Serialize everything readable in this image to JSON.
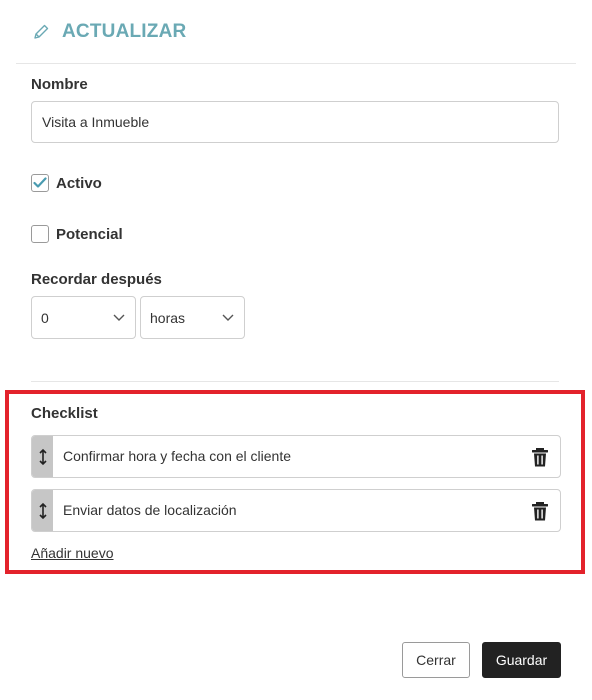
{
  "header": {
    "title": "ACTUALIZAR",
    "icon": "pencil-icon",
    "accent": "#6aa9b4"
  },
  "form": {
    "name_label": "Nombre",
    "name_value": "Visita a Inmueble",
    "active": {
      "label": "Activo",
      "checked": true
    },
    "potential": {
      "label": "Potencial",
      "checked": false
    },
    "remind_label": "Recordar después",
    "remind_value": "0",
    "remind_unit": "horas"
  },
  "checklist": {
    "title": "Checklist",
    "highlight_color": "#e3222b",
    "items": [
      {
        "text": "Confirmar hora y fecha con el cliente"
      },
      {
        "text": "Enviar datos de localización"
      }
    ],
    "add_label": "Añadir nuevo"
  },
  "footer": {
    "close_label": "Cerrar",
    "save_label": "Guardar"
  }
}
